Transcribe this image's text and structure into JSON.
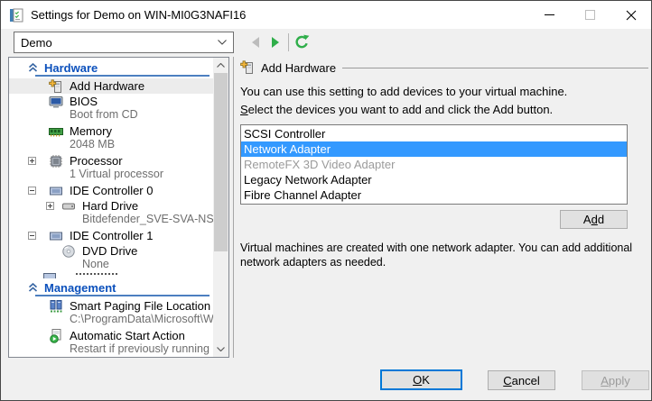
{
  "titlebar": {
    "title": "Settings for Demo on WIN-MI0G3NAFI16"
  },
  "toolbar": {
    "vm_selector_value": "Demo"
  },
  "sidebar": {
    "sections": [
      {
        "label": "Hardware",
        "items": [
          {
            "icon": "add-hardware-icon",
            "label": "Add Hardware"
          },
          {
            "icon": "bios-icon",
            "label": "BIOS",
            "sublabel": "Boot from CD"
          },
          {
            "icon": "memory-icon",
            "label": "Memory",
            "sublabel": "2048 MB"
          },
          {
            "icon": "processor-icon",
            "label": "Processor",
            "sublabel": "1 Virtual processor"
          },
          {
            "icon": "ide-controller-icon",
            "label": "IDE Controller 0"
          },
          {
            "icon": "hard-drive-icon",
            "label": "Hard Drive",
            "sublabel": "Bitdefender_SVE-SVA-NSV..."
          },
          {
            "icon": "ide-controller-icon",
            "label": "IDE Controller 1"
          },
          {
            "icon": "dvd-drive-icon",
            "label": "DVD Drive",
            "sublabel": "None"
          }
        ]
      },
      {
        "label": "Management",
        "items": [
          {
            "icon": "smart-paging-icon",
            "label": "Smart Paging File Location",
            "sublabel": "C:\\ProgramData\\Microsoft\\Win..."
          },
          {
            "icon": "auto-start-icon",
            "label": "Automatic Start Action",
            "sublabel": "Restart if previously running"
          }
        ]
      }
    ]
  },
  "panel": {
    "header": "Add Hardware",
    "description": "You can use this setting to add devices to your virtual machine.",
    "instruction": "Select the devices you want to add and click the Add button.",
    "device_list": [
      "SCSI Controller",
      "Network Adapter",
      "RemoteFX 3D Video Adapter",
      "Legacy Network Adapter",
      "Fibre Channel Adapter"
    ],
    "selected_device": "Network Adapter",
    "disabled_device": "RemoteFX 3D Video Adapter",
    "add_button": "Add",
    "note": "Virtual machines are created with one network adapter. You can add additional network adapters as needed."
  },
  "footer": {
    "ok": "OK",
    "cancel": "Cancel",
    "apply": "Apply"
  },
  "colors": {
    "selection_blue": "#3399ff",
    "section_header_blue": "#0b50bc",
    "accent_green": "#2fae4a",
    "default_button_border": "#0078d7",
    "button_face": "#e1e1e1"
  }
}
